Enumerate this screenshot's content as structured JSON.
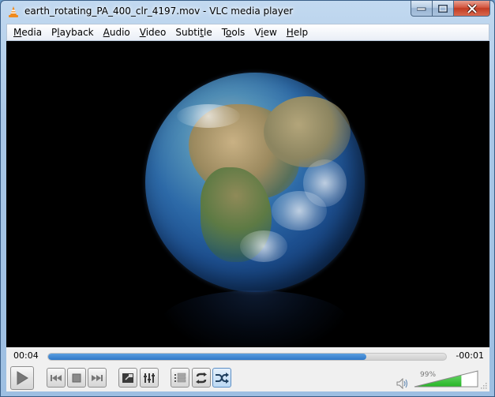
{
  "window": {
    "title": "earth_rotating_PA_400_clr_4197.mov - VLC media player",
    "app_icon": "vlc-cone-icon",
    "caption_buttons": [
      "minimize",
      "maximize",
      "close"
    ]
  },
  "menubar": {
    "items": [
      {
        "label": "Media",
        "accel": "M"
      },
      {
        "label": "Playback",
        "accel": "l"
      },
      {
        "label": "Audio",
        "accel": "A"
      },
      {
        "label": "Video",
        "accel": "V"
      },
      {
        "label": "Subtitle",
        "accel": "t"
      },
      {
        "label": "Tools",
        "accel": "o"
      },
      {
        "label": "View",
        "accel": "i"
      },
      {
        "label": "Help",
        "accel": "H"
      }
    ]
  },
  "video": {
    "content": "Rotating Earth globe showing Africa and Europe on black background"
  },
  "playback": {
    "elapsed": "00:04",
    "remaining": "-00:01",
    "progress_percent": 80
  },
  "controls": {
    "buttons": [
      {
        "name": "play",
        "icon": "play-icon"
      },
      {
        "name": "previous",
        "icon": "previous-icon"
      },
      {
        "name": "stop",
        "icon": "stop-icon"
      },
      {
        "name": "next",
        "icon": "next-icon"
      },
      {
        "name": "fullscreen",
        "icon": "fullscreen-icon"
      },
      {
        "name": "extended-settings",
        "icon": "equalizer-icon"
      },
      {
        "name": "playlist",
        "icon": "playlist-icon"
      },
      {
        "name": "loop",
        "icon": "loop-icon"
      },
      {
        "name": "random",
        "icon": "shuffle-icon",
        "active": true
      }
    ]
  },
  "volume": {
    "label": "99%",
    "level_percent": 99,
    "icon": "speaker-icon"
  },
  "colors": {
    "progress": "#2f78c7",
    "volume": "#2ec62e",
    "close_button": "#c23b22"
  }
}
